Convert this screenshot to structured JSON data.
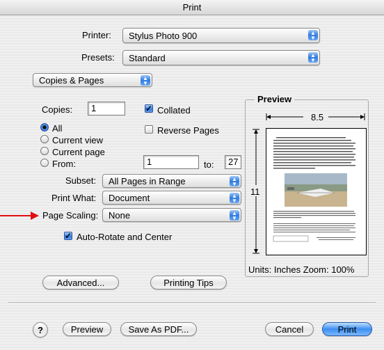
{
  "window": {
    "title": "Print"
  },
  "printer": {
    "label": "Printer:",
    "value": "Stylus Photo 900"
  },
  "presets": {
    "label": "Presets:",
    "value": "Standard"
  },
  "panel": {
    "value": "Copies & Pages"
  },
  "copies": {
    "label": "Copies:",
    "value": "1",
    "collated_label": "Collated",
    "collated": true,
    "reverse_label": "Reverse Pages",
    "reverse": false
  },
  "pages": {
    "all_label": "All",
    "current_view_label": "Current view",
    "current_page_label": "Current page",
    "from_label": "From:",
    "from_value": "1",
    "to_label": "to:",
    "to_value": "27",
    "selected": "All"
  },
  "subset": {
    "label": "Subset:",
    "value": "All Pages in Range"
  },
  "print_what": {
    "label": "Print What:",
    "value": "Document"
  },
  "page_scaling": {
    "label": "Page Scaling:",
    "value": "None"
  },
  "auto_rotate": {
    "label": "Auto-Rotate and Center",
    "checked": true
  },
  "preview": {
    "title": "Preview",
    "width_label": "8.5",
    "height_label": "11",
    "units_text": "Units: Inches Zoom: 100%"
  },
  "buttons": {
    "advanced": "Advanced...",
    "printing_tips": "Printing Tips",
    "help": "?",
    "preview": "Preview",
    "save_pdf": "Save As PDF...",
    "cancel": "Cancel",
    "print": "Print"
  },
  "colors": {
    "accent": "#2f7be0",
    "arrow": "#e01010"
  }
}
